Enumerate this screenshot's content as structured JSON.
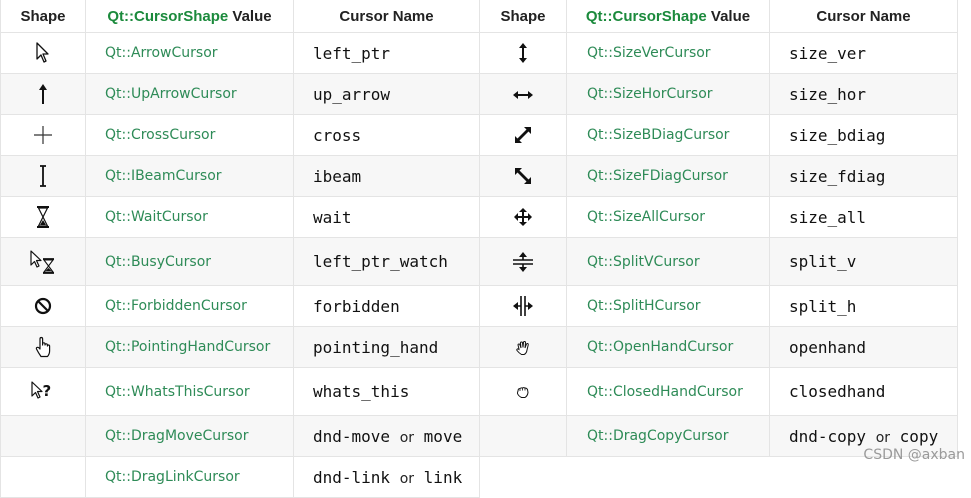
{
  "headers": {
    "shape": "Shape",
    "value_prefix": "Qt::CursorShape",
    "value_suffix": " Value",
    "name": "Cursor Name"
  },
  "rows": [
    {
      "left": {
        "icon": "arrow-cursor-icon",
        "value": "Qt::ArrowCursor",
        "name": "left_ptr"
      },
      "right": {
        "icon": "size-ver-cursor-icon",
        "value": "Qt::SizeVerCursor",
        "name": "size_ver"
      }
    },
    {
      "left": {
        "icon": "up-arrow-cursor-icon",
        "value": "Qt::UpArrowCursor",
        "name": "up_arrow"
      },
      "right": {
        "icon": "size-hor-cursor-icon",
        "value": "Qt::SizeHorCursor",
        "name": "size_hor"
      }
    },
    {
      "left": {
        "icon": "cross-cursor-icon",
        "value": "Qt::CrossCursor",
        "name": "cross"
      },
      "right": {
        "icon": "size-bdiag-cursor-icon",
        "value": "Qt::SizeBDiagCursor",
        "name": "size_bdiag"
      }
    },
    {
      "left": {
        "icon": "ibeam-cursor-icon",
        "value": "Qt::IBeamCursor",
        "name": "ibeam"
      },
      "right": {
        "icon": "size-fdiag-cursor-icon",
        "value": "Qt::SizeFDiagCursor",
        "name": "size_fdiag"
      }
    },
    {
      "left": {
        "icon": "wait-cursor-icon",
        "value": "Qt::WaitCursor",
        "name": "wait"
      },
      "right": {
        "icon": "size-all-cursor-icon",
        "value": "Qt::SizeAllCursor",
        "name": "size_all"
      }
    },
    {
      "left": {
        "icon": "busy-cursor-icon",
        "value": "Qt::BusyCursor",
        "name": "left_ptr_watch"
      },
      "right": {
        "icon": "split-v-cursor-icon",
        "value": "Qt::SplitVCursor",
        "name": "split_v"
      }
    },
    {
      "left": {
        "icon": "forbidden-cursor-icon",
        "value": "Qt::ForbiddenCursor",
        "name": "forbidden"
      },
      "right": {
        "icon": "split-h-cursor-icon",
        "value": "Qt::SplitHCursor",
        "name": "split_h"
      }
    },
    {
      "left": {
        "icon": "pointing-hand-cursor-icon",
        "value": "Qt::PointingHandCursor",
        "name": "pointing_hand"
      },
      "right": {
        "icon": "open-hand-cursor-icon",
        "value": "Qt::OpenHandCursor",
        "name": "openhand"
      }
    },
    {
      "left": {
        "icon": "whats-this-cursor-icon",
        "value": "Qt::WhatsThisCursor",
        "name": "whats_this"
      },
      "right": {
        "icon": "closed-hand-cursor-icon",
        "value": "Qt::ClosedHandCursor",
        "name": "closedhand"
      }
    },
    {
      "left": {
        "value": "Qt::DragMoveCursor",
        "name_a": "dnd-move",
        "or": "or",
        "name_b": "move"
      },
      "right": {
        "value": "Qt::DragCopyCursor",
        "name_a": "dnd-copy",
        "or": "or",
        "name_b": "copy"
      }
    },
    {
      "left": {
        "value": "Qt::DragLinkCursor",
        "name_a": "dnd-link",
        "or": "or",
        "name_b": "link"
      }
    }
  ],
  "watermark": "CSDN @axban"
}
